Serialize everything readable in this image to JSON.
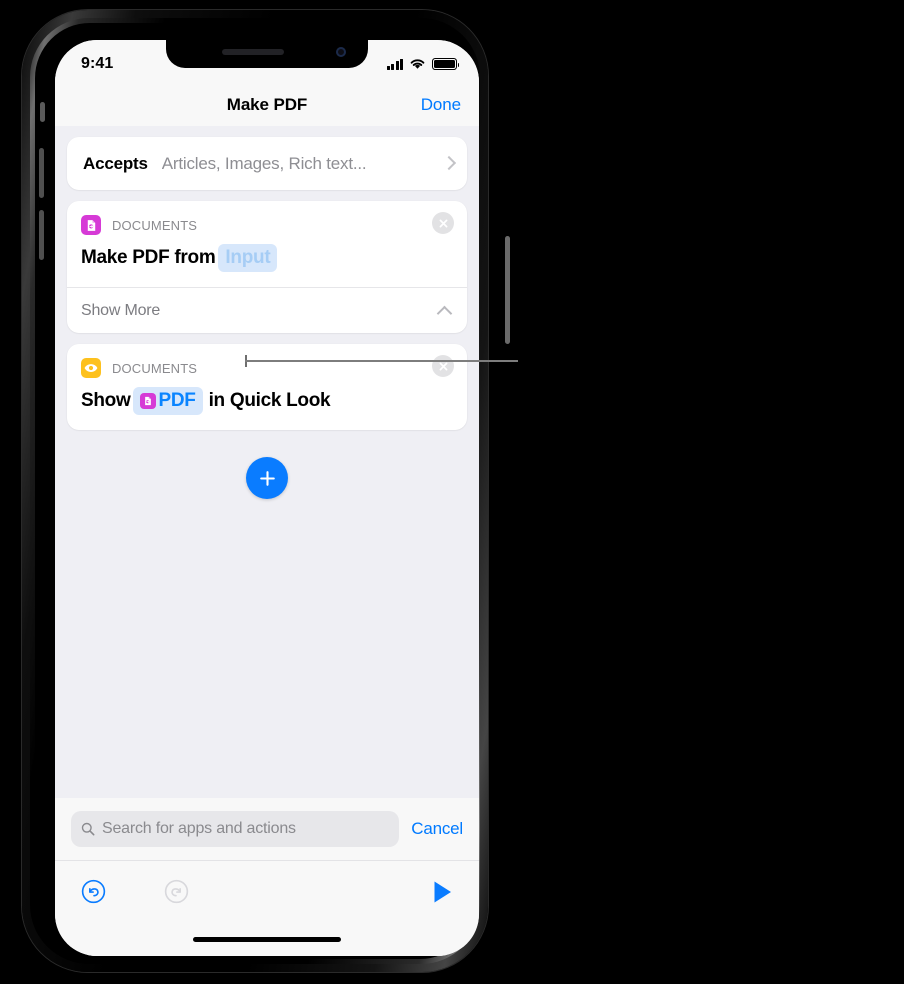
{
  "status_bar": {
    "time": "9:41",
    "cellular_icon": "signal-bars-icon",
    "wifi_icon": "wifi-icon",
    "battery_icon": "battery-icon"
  },
  "nav_bar": {
    "title": "Make PDF",
    "done_label": "Done"
  },
  "accepts_row": {
    "label": "Accepts",
    "value": "Articles, Images, Rich text...",
    "chevron_icon": "chevron-right-icon"
  },
  "actions": [
    {
      "app_icon": "make-pdf-document-icon",
      "app_icon_color": "#d63ad6",
      "category": "DOCUMENTS",
      "close_icon": "close-circle-icon",
      "text_before": "Make PDF from",
      "token": "Input",
      "token_type": "variable",
      "show_more_label": "Show More",
      "show_more_chevron": "chevron-up-icon"
    },
    {
      "app_icon": "quick-look-eye-icon",
      "app_icon_color": "#fdc11e",
      "category": "DOCUMENTS",
      "close_icon": "close-circle-icon",
      "text_before": "Show",
      "token": "PDF",
      "token_type": "magic-variable",
      "token_icon": "pdf-document-icon",
      "text_after": "in Quick Look"
    }
  ],
  "add_button": {
    "icon": "plus-icon",
    "color": "#0a7cff"
  },
  "search": {
    "icon": "search-icon",
    "placeholder": "Search for apps and actions",
    "value": "",
    "cancel_label": "Cancel"
  },
  "toolbar": {
    "undo_icon": "undo-icon",
    "undo_enabled": true,
    "redo_icon": "redo-icon",
    "redo_enabled": false,
    "play_icon": "play-icon"
  },
  "colors": {
    "accent_blue": "#007aff",
    "token_blue": "#0a84ff",
    "token_background": "#d7e7fb",
    "magenta": "#d63ad6",
    "yellow": "#fdc11e",
    "body_background": "#efeff4"
  },
  "callout": {
    "name": "callout-leader-line"
  }
}
